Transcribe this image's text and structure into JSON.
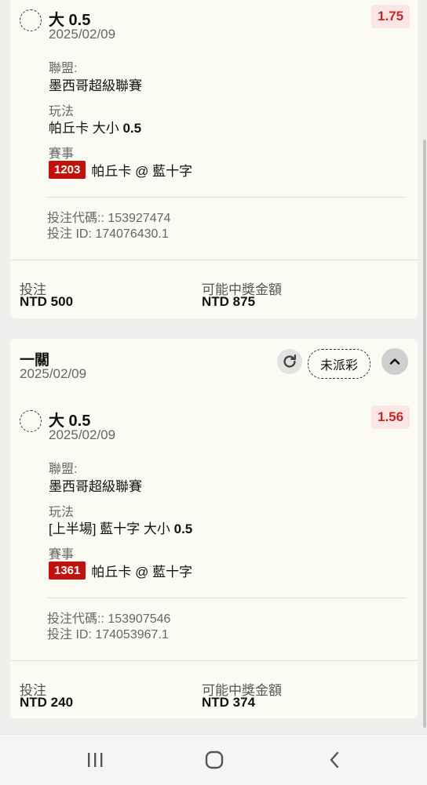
{
  "cards": [
    {
      "bet": {
        "title": "大 0.5",
        "date": "2025/02/09",
        "odds": "1.75",
        "league_label": "聯盟:",
        "league": "墨西哥超級聯賽",
        "market_label": "玩法",
        "market_prefix": "帕丘卡 大小 ",
        "market_line": "0.5",
        "event_label": "賽事",
        "event_id": "1203",
        "event_name": "帕丘卡 @ 藍十字",
        "code_line": "投注代碼:: 153927474",
        "id_line": "投注 ID: 174076430.1"
      },
      "stake_label": "投注",
      "stake": "NTD 500",
      "payout_label": "可能中獎金額",
      "payout": "NTD 875"
    },
    {
      "header": {
        "title": "一關",
        "date": "2025/02/09",
        "status": "未派彩"
      },
      "bet": {
        "title": "大 0.5",
        "date": "2025/02/09",
        "odds": "1.56",
        "league_label": "聯盟:",
        "league": "墨西哥超級聯賽",
        "market_label": "玩法",
        "market_prefix": "[上半場] 藍十字 大小 ",
        "market_line": "0.5",
        "event_label": "賽事",
        "event_id": "1361",
        "event_name": "帕丘卡 @ 藍十字",
        "code_line": "投注代碼:: 153907546",
        "id_line": "投注 ID: 174053967.1"
      },
      "stake_label": "投注",
      "stake": "NTD 240",
      "payout_label": "可能中獎金額",
      "payout": "NTD 374"
    }
  ],
  "icons": {
    "refresh": "refresh-icon",
    "collapse": "chevron-up-icon",
    "nav_recents": "recent-apps-icon",
    "nav_home": "home-icon",
    "nav_back": "back-icon"
  }
}
